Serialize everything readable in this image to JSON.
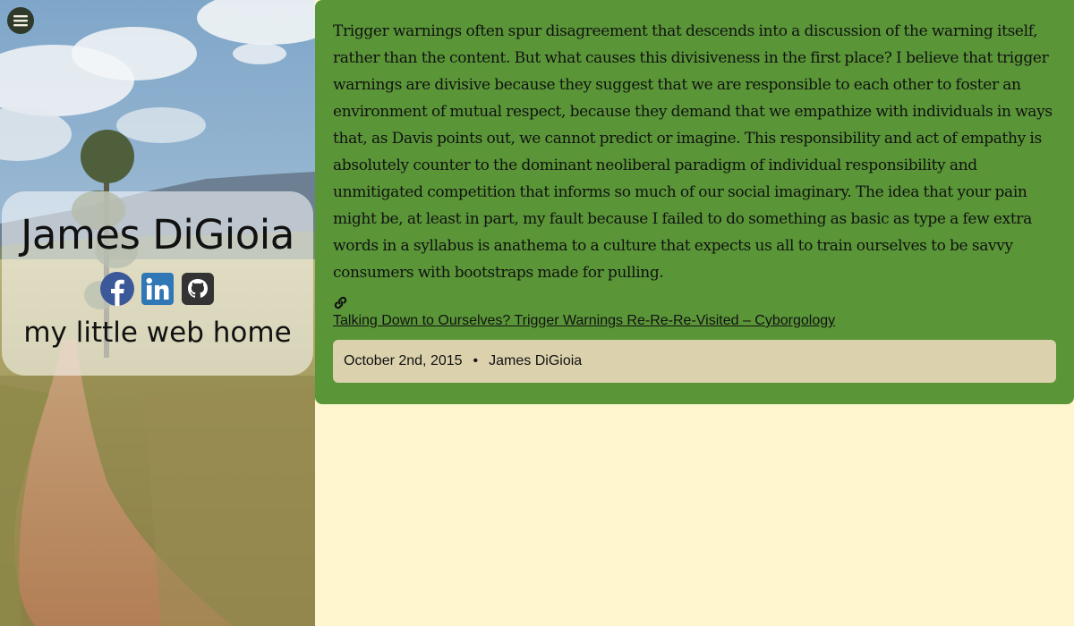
{
  "sidebar": {
    "menu_icon": "hamburger-menu-icon",
    "profile": {
      "name": "James DiGioia",
      "tagline": "my little web home"
    },
    "social": [
      {
        "name": "facebook",
        "icon": "facebook-icon",
        "color": "#3b5998"
      },
      {
        "name": "linkedin",
        "icon": "linkedin-icon",
        "color": "#2f77b5"
      },
      {
        "name": "github",
        "icon": "github-icon",
        "color": "#333333"
      }
    ]
  },
  "post": {
    "body": "Trigger warnings often spur disagreement that descends into a discussion of the warning itself, rather than the content. But what causes this divisiveness in the first place? I believe that trigger warnings are divisive because they suggest that we are responsible to each other to foster an environment of mutual respect, because they demand that we empathize with individuals in ways that, as Davis points out, we cannot predict or imagine. This responsibility and act of empathy is absolutely counter to the dominant neoliberal paradigm of individual responsibility and unmitigated competition that informs so much of our social imaginary. The idea that your pain might be, at least in part, my fault because I failed to do something as basic as type a few extra words in a syllabus is anathema to a culture that expects us all to train ourselves to be savvy consumers with bootstraps made for pulling.",
    "link_icon": "link-icon",
    "link_text": "Talking Down to Ourselves? Trigger Warnings Re-Re-Re-Visited – Cyborgology",
    "meta": {
      "date": "October 2nd, 2015",
      "separator": "•",
      "author": "James DiGioia"
    }
  },
  "colors": {
    "post_background": "#5a9638",
    "meta_background": "#dcd1ad",
    "page_background": "#fff5cf"
  }
}
